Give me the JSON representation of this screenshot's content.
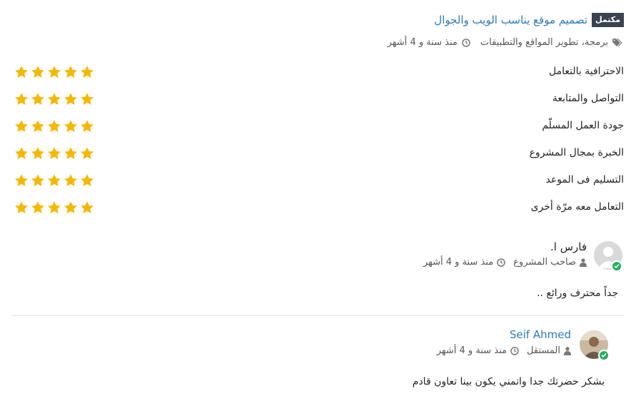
{
  "project": {
    "badge": "مكتمل",
    "title": "تصميم موقع يناسب الويب والجوال",
    "tags": "برمجة، تطوير المواقع والتطبيقات",
    "time": "منذ سنة و 4 أشهر"
  },
  "ratings": [
    {
      "label": "الاحترافية بالتعامل",
      "stars": 5
    },
    {
      "label": "التواصل والمتابعة",
      "stars": 5
    },
    {
      "label": "جودة العمل المسلّم",
      "stars": 5
    },
    {
      "label": "الخبرة بمجال المشروع",
      "stars": 5
    },
    {
      "label": "التسليم فى الموعد",
      "stars": 5
    },
    {
      "label": "التعامل معه مرّة أخرى",
      "stars": 5
    }
  ],
  "reviews": [
    {
      "name": "فارس ا.",
      "role": "صاحب المشروع",
      "time": "منذ سنة و 4 أشهر",
      "comment": "جداً محترف ورائع .."
    },
    {
      "name": "Seif Ahmed",
      "role": "المستقل",
      "time": "منذ سنة و 4 أشهر",
      "comment": "بشكر حضرتك جدا واتمني يكون بينا تعاون قادم"
    }
  ],
  "colors": {
    "star": "#f5b800",
    "link": "#2b7bb9",
    "badge": "#3b4350",
    "online": "#27ae60"
  }
}
